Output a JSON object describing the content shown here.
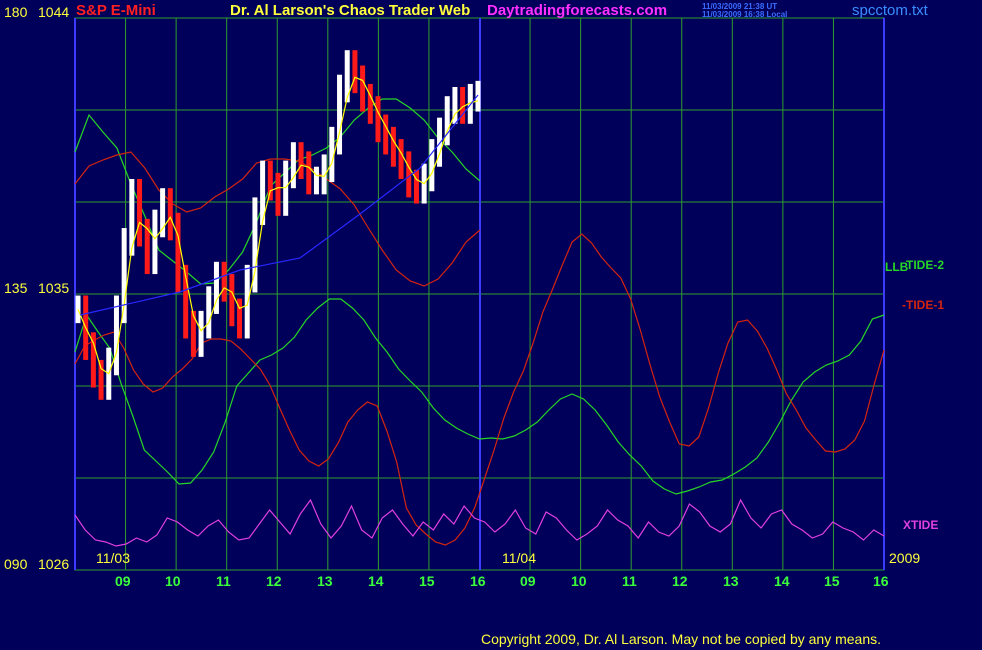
{
  "header": {
    "symbol": "S&P E-Mini",
    "title": "Dr. Al Larson's Chaos Trader Web",
    "site": "Daytradingforecasts.com",
    "stamp_ut": "11/03/2009 21:38 UT",
    "stamp_local": "11/03/2009 16:38 Local",
    "filename": "spcctom.txt"
  },
  "y_labels": [
    {
      "left": "180",
      "right": "1044"
    },
    {
      "left": "135",
      "right": "1035"
    },
    {
      "left": "090",
      "right": "1026"
    }
  ],
  "footer": {
    "date_start": "11/03",
    "date_mid": "11/04",
    "year": "2009",
    "copyright": "Copyright 2009, Dr. Al Larson. May not be copied by any means."
  },
  "legend": {
    "tide2": "TIDE-2",
    "tide1": "-TIDE-1",
    "llb": "LLB",
    "xtide": "XTIDE"
  },
  "colors": {
    "background": "#00005a",
    "grid": "#2e9e2e",
    "tide2": "#26d626",
    "tide1": "#d42410",
    "xtide": "#e040e0",
    "bars_up": "#ffffff",
    "bars_down": "#ff1a1a",
    "ma": "#ffff00",
    "trend": "#2828ff",
    "labels_yellow": "#ffff3c"
  },
  "chart_data": {
    "type": "line",
    "title": "S&P E-Mini",
    "y_range_price": [
      1026,
      1044
    ],
    "y_range_angle": [
      90,
      180
    ],
    "x_ticks": [
      "09",
      "10",
      "11",
      "12",
      "13",
      "14",
      "15",
      "16",
      "09",
      "10",
      "11",
      "12",
      "13",
      "14",
      "15",
      "16"
    ],
    "x_dates": [
      "11/03",
      "11/04"
    ],
    "series": [
      {
        "name": "TIDE-2",
        "values": [
          218,
          255,
          238,
          222,
          186,
          154,
          120,
          109,
          98,
          86,
          87,
          100,
          118,
          148,
          184,
          197,
          210,
          215,
          222,
          233,
          250,
          262,
          271,
          271,
          262,
          250,
          232,
          218,
          201,
          189,
          178,
          162,
          150,
          142,
          136,
          131,
          132,
          131,
          134,
          140,
          148,
          160,
          171,
          176,
          171,
          160,
          145,
          128,
          115,
          104,
          89,
          81,
          76,
          79,
          83,
          88,
          90,
          96,
          103,
          112,
          128,
          148,
          170,
          188,
          198,
          205,
          209,
          215,
          229,
          251,
          255
        ]
      },
      {
        "name": "-TIDE-1",
        "values": [
          206,
          224,
          230,
          235,
          238,
          222,
          200,
          186,
          178,
          182,
          193,
          201,
          211,
          227,
          231,
          231,
          229,
          221,
          211,
          201,
          185,
          162,
          140,
          120,
          109,
          104,
          111,
          127,
          148,
          160,
          168,
          164,
          139,
          108,
          62,
          45,
          36,
          28,
          25,
          30,
          42,
          62,
          91,
          120,
          152,
          178,
          199,
          227,
          258,
          281,
          305,
          328,
          336,
          327,
          313,
          302,
          292,
          271,
          240,
          205,
          173,
          148,
          126,
          124,
          133,
          162,
          197,
          227,
          248,
          250,
          239,
          222,
          200,
          176,
          160,
          142,
          130,
          119,
          118,
          121,
          130,
          149,
          186,
          220
        ]
      },
      {
        "name": "XTIDE",
        "values": [
          55,
          40,
          30,
          28,
          24,
          26,
          32,
          28,
          35,
          52,
          48,
          40,
          34,
          44,
          50,
          38,
          30,
          32,
          46,
          60,
          48,
          36,
          56,
          70,
          46,
          32,
          44,
          64,
          40,
          32,
          52,
          60,
          46,
          34,
          48,
          40,
          56,
          46,
          64,
          52,
          48,
          38,
          46,
          60,
          42,
          36,
          58,
          52,
          40,
          30,
          36,
          44,
          60,
          50,
          44,
          32,
          48,
          38,
          34,
          44,
          66,
          58,
          44,
          38,
          46,
          70,
          52,
          42,
          56,
          60,
          46,
          40,
          32,
          36,
          48,
          42,
          38,
          30,
          40,
          34
        ]
      },
      {
        "name": "Price (S&P E-Mini)",
        "values": [
          1034.5,
          1033.3,
          1032.4,
          1032.0,
          1032.8,
          1034.5,
          1036.7,
          1038.3,
          1037.0,
          1036.1,
          1037.3,
          1038.0,
          1037.2,
          1035.5,
          1034.0,
          1033.4,
          1034.0,
          1034.8,
          1035.6,
          1035.2,
          1034.4,
          1034.0,
          1035.5,
          1037.7,
          1038.9,
          1038.5,
          1038.0,
          1038.9,
          1039.5,
          1039.2,
          1038.7,
          1038.7,
          1039.1,
          1040.0,
          1041.7,
          1042.5,
          1042.0,
          1041.4,
          1041.0,
          1040.4,
          1040.0,
          1039.6,
          1039.2,
          1038.6,
          1038.4,
          1038.8,
          1039.6,
          1040.3,
          1041.0,
          1041.3,
          1041.0,
          1041.4,
          1041.5
        ]
      }
    ]
  }
}
